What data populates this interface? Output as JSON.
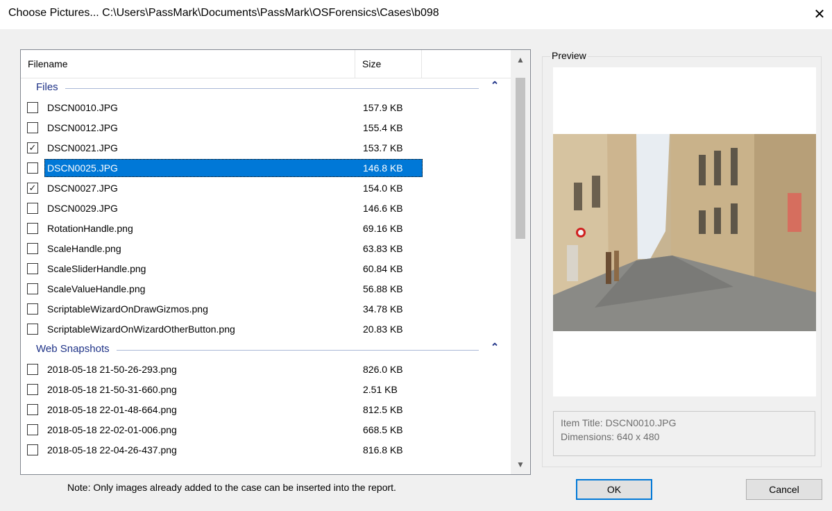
{
  "window": {
    "title": "Choose Pictures... C:\\Users\\PassMark\\Documents\\PassMark\\OSForensics\\Cases\\b098",
    "close_glyph": "✕"
  },
  "list": {
    "columns": {
      "filename": "Filename",
      "size": "Size"
    },
    "groups": [
      {
        "name": "Files",
        "items": [
          {
            "name": "DSCN0010.JPG",
            "size": "157.9 KB",
            "checked": false,
            "selected": false
          },
          {
            "name": "DSCN0012.JPG",
            "size": "155.4 KB",
            "checked": false,
            "selected": false
          },
          {
            "name": "DSCN0021.JPG",
            "size": "153.7 KB",
            "checked": true,
            "selected": false
          },
          {
            "name": "DSCN0025.JPG",
            "size": "146.8 KB",
            "checked": false,
            "selected": true
          },
          {
            "name": "DSCN0027.JPG",
            "size": "154.0 KB",
            "checked": true,
            "selected": false
          },
          {
            "name": "DSCN0029.JPG",
            "size": "146.6 KB",
            "checked": false,
            "selected": false
          },
          {
            "name": "RotationHandle.png",
            "size": "69.16 KB",
            "checked": false,
            "selected": false
          },
          {
            "name": "ScaleHandle.png",
            "size": "63.83 KB",
            "checked": false,
            "selected": false
          },
          {
            "name": "ScaleSliderHandle.png",
            "size": "60.84 KB",
            "checked": false,
            "selected": false
          },
          {
            "name": "ScaleValueHandle.png",
            "size": "56.88 KB",
            "checked": false,
            "selected": false
          },
          {
            "name": "ScriptableWizardOnDrawGizmos.png",
            "size": "34.78 KB",
            "checked": false,
            "selected": false
          },
          {
            "name": "ScriptableWizardOnWizardOtherButton.png",
            "size": "20.83 KB",
            "checked": false,
            "selected": false
          }
        ]
      },
      {
        "name": "Web Snapshots",
        "items": [
          {
            "name": "2018-05-18 21-50-26-293.png",
            "size": "826.0 KB",
            "checked": false,
            "selected": false
          },
          {
            "name": "2018-05-18 21-50-31-660.png",
            "size": "2.51 KB",
            "checked": false,
            "selected": false
          },
          {
            "name": "2018-05-18 22-01-48-664.png",
            "size": "812.5 KB",
            "checked": false,
            "selected": false
          },
          {
            "name": "2018-05-18 22-02-01-006.png",
            "size": "668.5 KB",
            "checked": false,
            "selected": false
          },
          {
            "name": "2018-05-18 22-04-26-437.png",
            "size": "816.8 KB",
            "checked": false,
            "selected": false
          }
        ]
      }
    ],
    "scroll_fraction": 0
  },
  "note": "Note: Only images already added to the case can be inserted into the report.",
  "preview": {
    "legend": "Preview",
    "item_title": "Item Title: DSCN0010.JPG",
    "dimensions": "Dimensions: 640 x 480"
  },
  "buttons": {
    "ok": "OK",
    "cancel": "Cancel"
  },
  "icons": {
    "check": "check-icon",
    "collapse": "chevron-up-icon",
    "scroll_up": "scroll-up-arrow-icon",
    "scroll_down": "scroll-down-arrow-icon",
    "close": "close-icon"
  },
  "colors": {
    "accent": "#0078d7",
    "group_text": "#1e3287",
    "face": "#f0f0f0"
  }
}
